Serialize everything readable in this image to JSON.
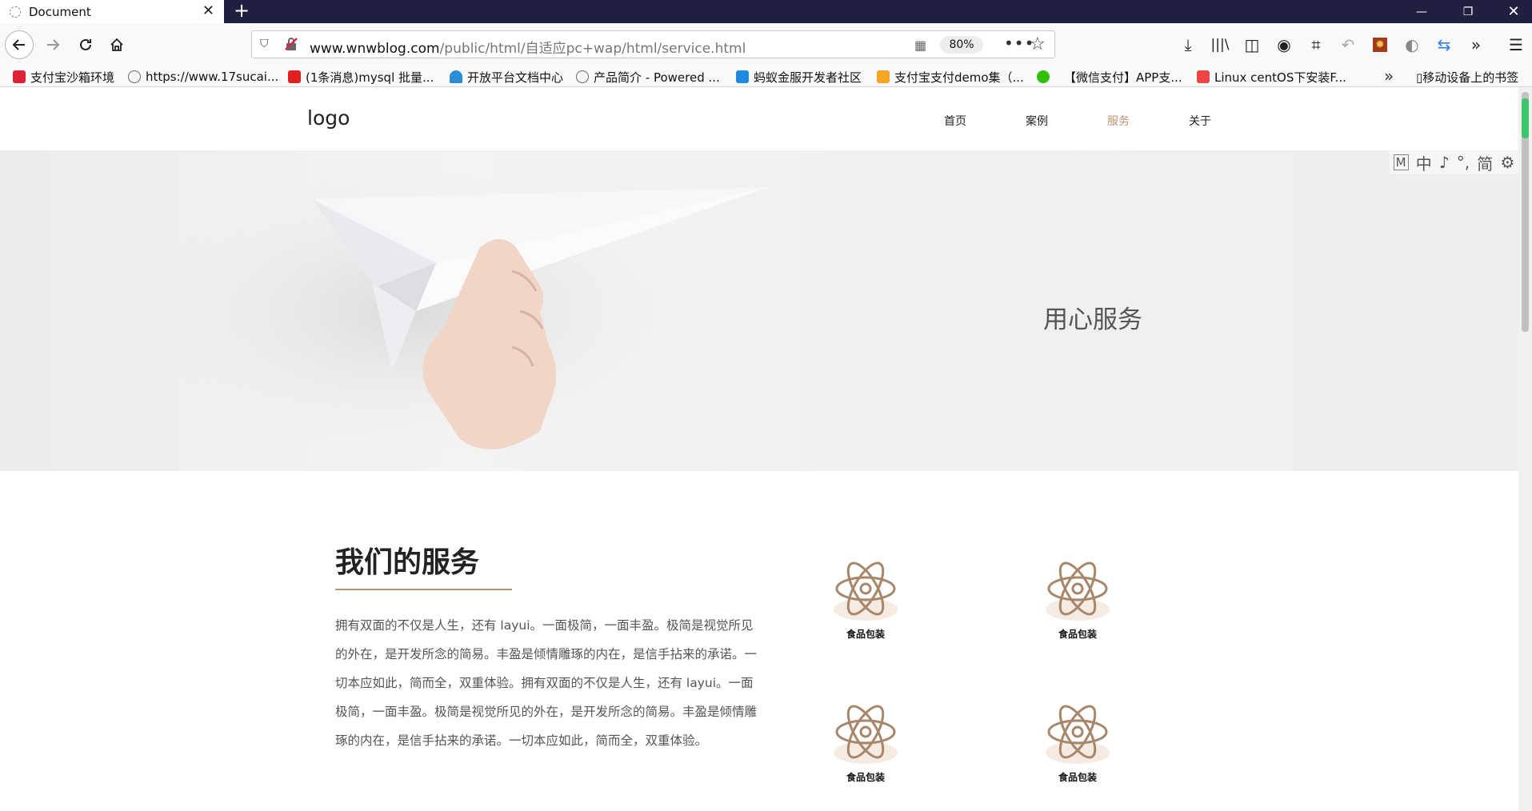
{
  "browser": {
    "tab_title": "Document",
    "url_host": "www.wnwblog.com",
    "url_path": "/public/html/自适应pc+wap/html/service.html",
    "zoom": "80%",
    "bookmarks": [
      {
        "label": "支付宝沙箱环境",
        "icon": "shield-icon",
        "color": "#d23"
      },
      {
        "label": "https://www.17sucai...",
        "icon": "globe-icon",
        "color": "#666"
      },
      {
        "label": "(1条消息)mysql 批量...",
        "icon": "csdn-icon",
        "color": "#e02020"
      },
      {
        "label": "开放平台文档中心",
        "icon": "person-icon",
        "color": "#2a8fd8"
      },
      {
        "label": "产品简介 - Powered ...",
        "icon": "globe-icon",
        "color": "#666"
      },
      {
        "label": "蚂蚁金服开发者社区",
        "icon": "ant-icon",
        "color": "#1e88e5"
      },
      {
        "label": "支付宝支付demo集（...",
        "icon": "fox-icon",
        "color": "#f4a623"
      },
      {
        "label": "",
        "icon": "wechat-icon",
        "color": "#2dc100"
      },
      {
        "label": "【微信支付】APP支...",
        "icon": "none",
        "color": ""
      },
      {
        "label": "Linux centOS下安装F...",
        "icon": "jian-icon",
        "color": "#e44"
      }
    ],
    "mobile_bookmarks": "移动设备上的书签"
  },
  "site": {
    "logo": "logo",
    "nav": [
      {
        "label": "首页",
        "active": false
      },
      {
        "label": "案例",
        "active": false
      },
      {
        "label": "服务",
        "active": true
      },
      {
        "label": "关于",
        "active": false
      }
    ],
    "banner_title": "用心服务",
    "ime_toolbar": [
      "M",
      "中",
      "♪",
      "°,",
      "简",
      "⚙"
    ],
    "section": {
      "title": "我们的服务",
      "description": "拥有双面的不仅是人生，还有 layui。一面极简，一面丰盈。极简是视觉所见的外在，是开发所念的简易。丰盈是倾情雕琢的内在，是信手拈来的承诺。一切本应如此，简而全，双重体验。拥有双面的不仅是人生，还有 layui。一面极简，一面丰盈。极简是视觉所见的外在，是开发所念的简易。丰盈是倾情雕琢的内在，是信手拈来的承诺。一切本应如此，简而全，双重体验。"
    },
    "services": [
      {
        "label": "食品包装",
        "icon": "atom-icon"
      },
      {
        "label": "食品包装",
        "icon": "atom-icon"
      },
      {
        "label": "食品包装",
        "icon": "atom-icon"
      },
      {
        "label": "食品包装",
        "icon": "atom-icon"
      }
    ],
    "accent_color": "#b89373"
  }
}
